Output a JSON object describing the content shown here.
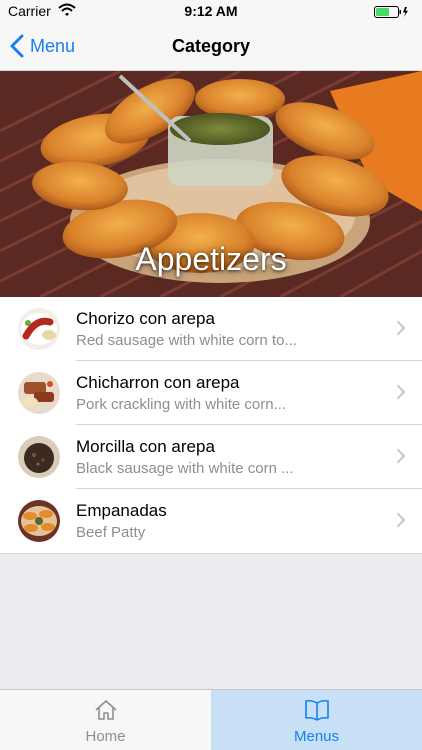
{
  "status": {
    "carrier": "Carrier",
    "time": "9:12 AM"
  },
  "nav": {
    "back_label": "Menu",
    "title": "Category",
    "accent": "#1a7ef0"
  },
  "hero": {
    "title": "Appetizers"
  },
  "items": [
    {
      "name": "Chorizo con arepa",
      "description": "Red sausage with white corn to...",
      "thumb": "chorizo-thumbnail"
    },
    {
      "name": "Chicharron con arepa",
      "description": "Pork crackling with white corn...",
      "thumb": "chicharron-thumbnail"
    },
    {
      "name": "Morcilla con arepa",
      "description": "Black sausage with white corn ...",
      "thumb": "morcilla-thumbnail"
    },
    {
      "name": "Empanadas",
      "description": "Beef Patty",
      "thumb": "empanadas-thumbnail"
    }
  ],
  "tabs": [
    {
      "label": "Home",
      "icon": "house-icon",
      "selected": false
    },
    {
      "label": "Menus",
      "icon": "book-icon",
      "selected": true
    }
  ]
}
